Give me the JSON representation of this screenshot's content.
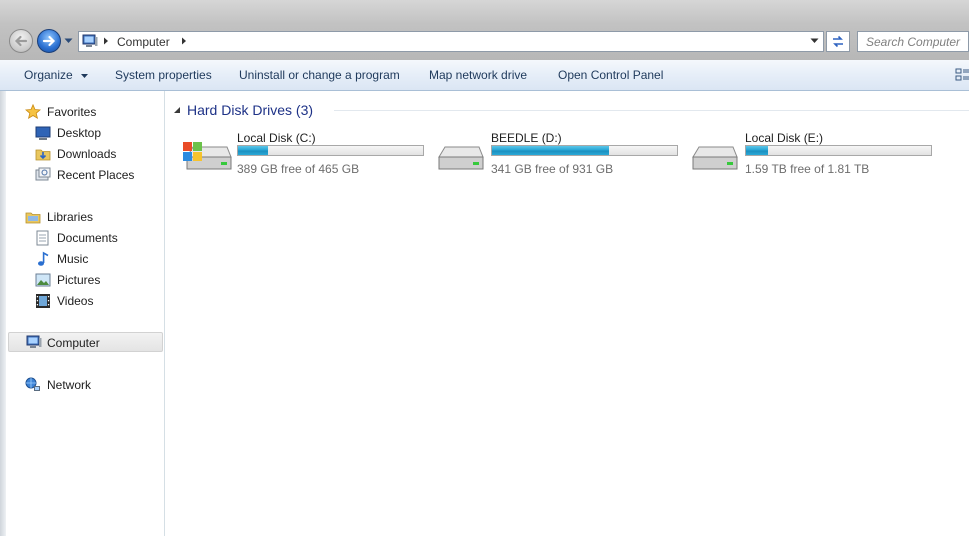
{
  "address_bar": {
    "path_segment": "Computer",
    "search_placeholder": "Search Computer"
  },
  "command_bar": {
    "organize": "Organize",
    "system_properties": "System properties",
    "uninstall": "Uninstall or change a program",
    "map_drive": "Map network drive",
    "control_panel": "Open Control Panel"
  },
  "nav_pane": {
    "favorites": "Favorites",
    "desktop": "Desktop",
    "downloads": "Downloads",
    "recent_places": "Recent Places",
    "libraries": "Libraries",
    "documents": "Documents",
    "music": "Music",
    "pictures": "Pictures",
    "videos": "Videos",
    "computer": "Computer",
    "network": "Network"
  },
  "content": {
    "group_title": "Hard Disk Drives (3)",
    "drives": [
      {
        "name": "Local Disk (C:)",
        "free_text": "389 GB free of 465 GB",
        "used_fraction": 0.16
      },
      {
        "name": "BEEDLE (D:)",
        "free_text": "341 GB free of 931 GB",
        "used_fraction": 0.63
      },
      {
        "name": "Local Disk (E:)",
        "free_text": "1.59 TB free of 1.81 TB",
        "used_fraction": 0.12
      }
    ]
  },
  "colors": {
    "bar_fill": "#27a6d6",
    "group_title": "#1e3287"
  }
}
